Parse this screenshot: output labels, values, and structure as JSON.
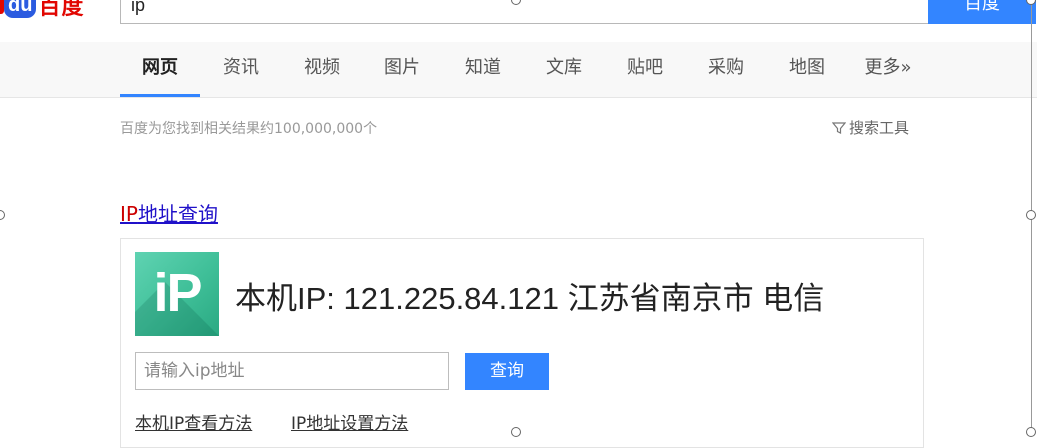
{
  "logo": {
    "du": "du",
    "text": "百度"
  },
  "search": {
    "query": "ip",
    "button": "百度"
  },
  "tabs": [
    {
      "label": "网页",
      "active": true
    },
    {
      "label": "资讯"
    },
    {
      "label": "视频"
    },
    {
      "label": "图片"
    },
    {
      "label": "知道"
    },
    {
      "label": "文库"
    },
    {
      "label": "贴吧"
    },
    {
      "label": "采购"
    },
    {
      "label": "地图"
    },
    {
      "label": "更多»"
    }
  ],
  "result_count": "百度为您找到相关结果约100,000,000个",
  "search_tools": "搜索工具",
  "result": {
    "title_highlight": "IP",
    "title_rest": "地址查询",
    "card": {
      "logo_text": "iP",
      "ip_line": "本机IP: 121.225.84.121  江苏省南京市 电信",
      "input_placeholder": "请输入ip地址",
      "query_button": "查询",
      "links": [
        "本机IP查看方法",
        "IP地址设置方法"
      ]
    }
  },
  "colors": {
    "accent": "#3385ff",
    "brand_red": "#e10601",
    "link": "#2011c9",
    "highlight": "#cc0000"
  }
}
